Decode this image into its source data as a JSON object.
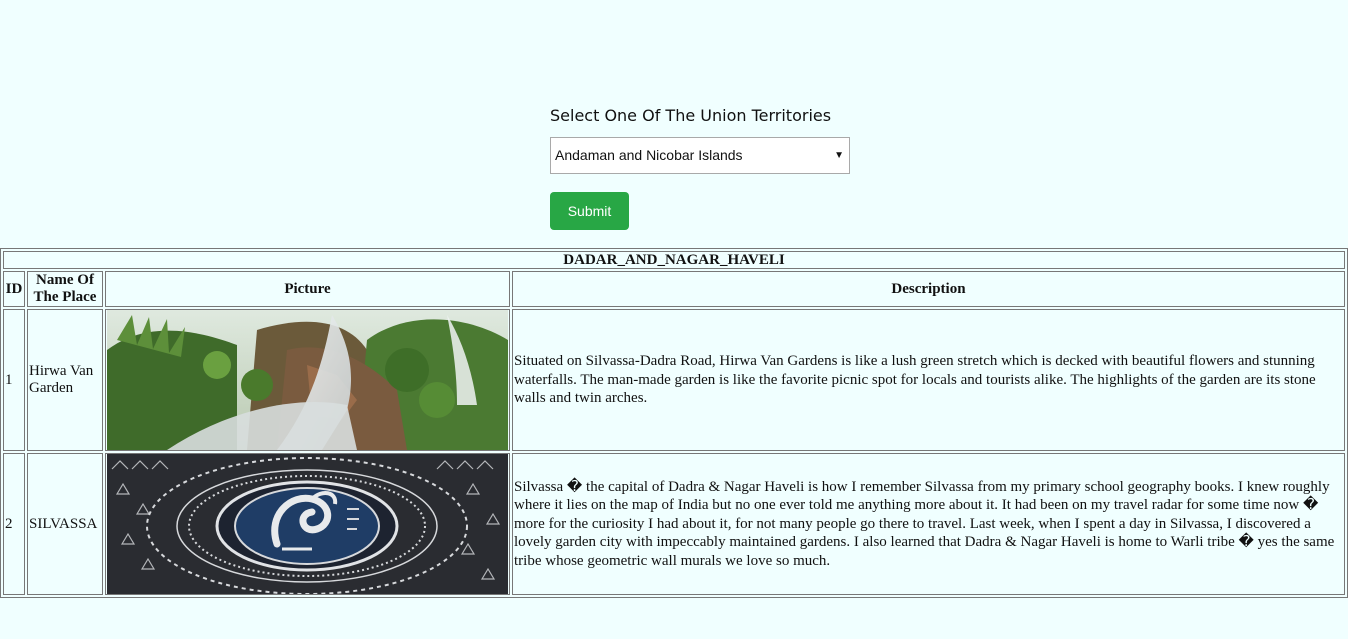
{
  "form": {
    "label": "Select One Of The Union Territories",
    "selected": "Andaman and Nicobar Islands",
    "submit_label": "Submit"
  },
  "table": {
    "title": "DADAR_AND_NAGAR_HAVELI",
    "headers": {
      "id": "ID",
      "name": "Name Of The Place",
      "picture": "Picture",
      "description": "Description"
    },
    "rows": [
      {
        "id": "1",
        "name": "Hirwa Van Garden",
        "picture": "waterfall-garden-photo",
        "description": "Situated on Silvassa-Dadra Road, Hirwa Van Gardens is like a lush green stretch which is decked with beautiful flowers and stunning waterfalls. The man-made garden is like the favorite picnic spot for locals and tourists alike. The highlights of the garden are its stone walls and twin arches."
      },
      {
        "id": "2",
        "name": "SILVASSA",
        "picture": "warli-art-mural-photo",
        "description": "Silvassa � the capital of Dadra & Nagar Haveli is how I remember Silvassa from my primary school geography books. I knew roughly where it lies on the map of India but no one ever told me anything more about it. It had been on my travel radar for some time now � more for the curiosity I had about it, for not many people go there to travel. Last week, when I spent a day in Silvassa, I discovered a lovely garden city with impeccably maintained gardens. I also learned that Dadra & Nagar Haveli is home to Warli tribe � yes the same tribe whose geometric wall murals we love so much."
      }
    ]
  },
  "colors": {
    "page_bg": "#f0ffff",
    "submit_bg": "#28a745",
    "border": "#777777"
  }
}
